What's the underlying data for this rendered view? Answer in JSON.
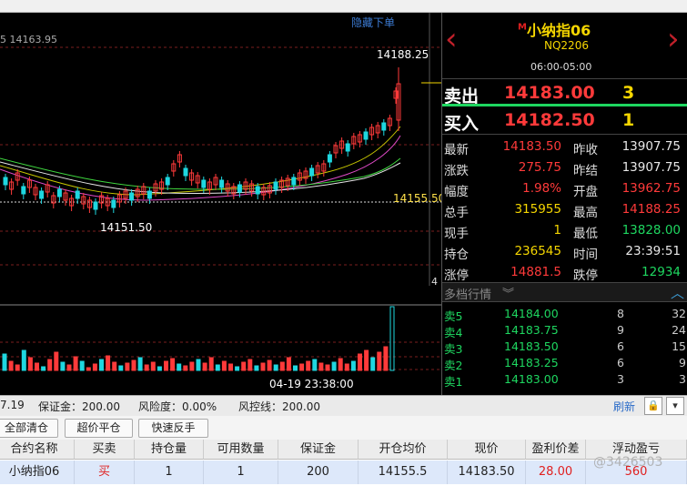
{
  "chart": {
    "hide_label": "隐藏下单",
    "ref_line_label": "5 14163.95",
    "high_label": "14188.25",
    "low_label": "14151.50",
    "price_line_label": "14155.50",
    "scale_label": "4",
    "time_label": "04-19 23:38:00"
  },
  "quote": {
    "title": "小纳指06",
    "marker": "M",
    "code": "NQ2206",
    "session": "06:00-05:00",
    "ask_label": "卖出",
    "ask_price": "14183.00",
    "ask_qty": "3",
    "bid_label": "买入",
    "bid_price": "14182.50",
    "bid_qty": "1",
    "rows": [
      {
        "l": "最新",
        "v": "14183.50",
        "vc": "red",
        "l2": "昨收",
        "v2": "13907.75",
        "v2c": "white"
      },
      {
        "l": "涨跌",
        "v": "275.75",
        "vc": "red",
        "l2": "昨结",
        "v2": "13907.75",
        "v2c": "white"
      },
      {
        "l": "幅度",
        "v": "1.98%",
        "vc": "red",
        "l2": "开盘",
        "v2": "13962.75",
        "v2c": "red"
      },
      {
        "l": "总手",
        "v": "315955",
        "vc": "yellow",
        "l2": "最高",
        "v2": "14188.25",
        "v2c": "red"
      },
      {
        "l": "现手",
        "v": "1",
        "vc": "yellow",
        "l2": "最低",
        "v2": "13828.00",
        "v2c": "green"
      },
      {
        "l": "持仓",
        "v": "236545",
        "vc": "yellow",
        "l2": "时间",
        "v2": "23:39:51",
        "v2c": "white"
      },
      {
        "l": "涨停",
        "v": "14881.5",
        "vc": "red",
        "l2": "跌停",
        "v2": "12934",
        "v2c": "green"
      }
    ],
    "depth_title": "多档行情",
    "depth": [
      {
        "name": "卖5",
        "price": "14184.00",
        "q": "8",
        "r": "32"
      },
      {
        "name": "卖4",
        "price": "14183.75",
        "q": "9",
        "r": "24"
      },
      {
        "name": "卖3",
        "price": "14183.50",
        "q": "6",
        "r": "15"
      },
      {
        "name": "卖2",
        "price": "14183.25",
        "q": "6",
        "r": "9"
      },
      {
        "name": "卖1",
        "price": "14183.00",
        "q": "3",
        "r": "3"
      }
    ]
  },
  "status": {
    "balance": "7.19",
    "margin": "保证金：200.00",
    "risk": "风险度：0.00%",
    "risk_line": "风控线：200.00",
    "refresh": "刷新"
  },
  "actions": {
    "close_all": "全部清仓",
    "limit_close": "超价平仓",
    "reverse": "快速反手"
  },
  "table": {
    "headers": [
      "合约名称",
      "买卖",
      "持仓量",
      "可用数量",
      "保证金",
      "开仓均价",
      "现价",
      "盈利价差",
      "浮动盈亏"
    ],
    "row": [
      "小纳指06",
      "买",
      "1",
      "1",
      "200",
      "14155.5",
      "14183.50",
      "28.00",
      "560"
    ]
  },
  "watermark": "@3426503",
  "colors": {
    "up": "#ff3a3a",
    "down": "#1ed760",
    "accent": "#f5d600",
    "link": "#2a6bc8"
  }
}
